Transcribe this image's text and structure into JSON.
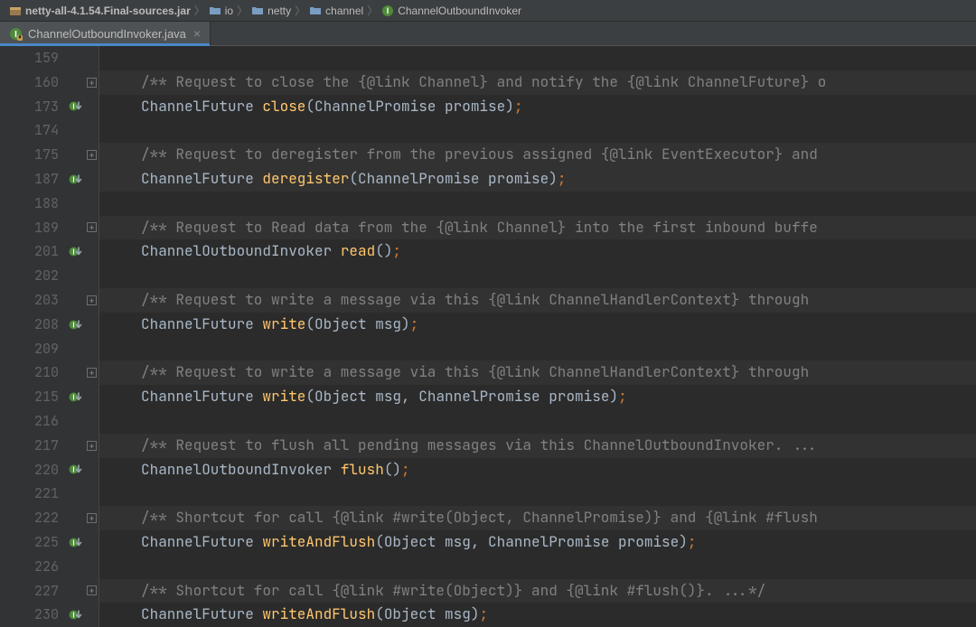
{
  "breadcrumb": {
    "jar": "netty-all-4.1.54.Final-sources.jar",
    "seg1": "io",
    "seg2": "netty",
    "seg3": "channel",
    "cls": "ChannelOutboundInvoker"
  },
  "tab": {
    "label": "ChannelOutboundInvoker.java"
  },
  "lines": [
    {
      "n": "159",
      "icon": "",
      "fold": "",
      "code": {
        "indent": "",
        "tokens": []
      },
      "bg": ""
    },
    {
      "n": "160",
      "icon": "",
      "fold": "+",
      "code": {
        "indent": "",
        "tokens": [
          [
            "comment",
            "/** Request to close the {@link Channel} and notify the {@link ChannelFuture} o"
          ]
        ]
      },
      "bg": "c"
    },
    {
      "n": "173",
      "icon": "impl",
      "fold": "",
      "code": {
        "indent": "",
        "tokens": [
          [
            "type",
            "ChannelFuture "
          ],
          [
            "method",
            "close"
          ],
          [
            "paren",
            "("
          ],
          [
            "type",
            "ChannelPromise promise"
          ],
          [
            "paren",
            ")"
          ],
          [
            "semi",
            ";"
          ]
        ]
      },
      "bg": ""
    },
    {
      "n": "174",
      "icon": "",
      "fold": "",
      "code": {
        "indent": "",
        "tokens": []
      },
      "bg": ""
    },
    {
      "n": "175",
      "icon": "",
      "fold": "+",
      "code": {
        "indent": "",
        "tokens": [
          [
            "comment",
            "/** Request to deregister from the previous assigned {@link EventExecutor} and"
          ]
        ]
      },
      "bg": "c"
    },
    {
      "n": "187",
      "icon": "impl",
      "fold": "",
      "code": {
        "indent": "",
        "tokens": [
          [
            "type",
            "ChannelFuture "
          ],
          [
            "method",
            "deregister"
          ],
          [
            "paren",
            "("
          ],
          [
            "type",
            "ChannelPromise promise"
          ],
          [
            "paren",
            ")"
          ],
          [
            "semi",
            ";"
          ]
        ]
      },
      "bg": "cur"
    },
    {
      "n": "188",
      "icon": "",
      "fold": "",
      "code": {
        "indent": "",
        "tokens": []
      },
      "bg": ""
    },
    {
      "n": "189",
      "icon": "",
      "fold": "+",
      "code": {
        "indent": "",
        "tokens": [
          [
            "comment",
            "/** Request to Read data from the {@link Channel} into the first inbound buffe"
          ]
        ]
      },
      "bg": "c"
    },
    {
      "n": "201",
      "icon": "impl",
      "fold": "",
      "code": {
        "indent": "",
        "tokens": [
          [
            "type",
            "ChannelOutboundInvoker "
          ],
          [
            "method",
            "read"
          ],
          [
            "paren",
            "()"
          ],
          [
            "semi",
            ";"
          ]
        ]
      },
      "bg": ""
    },
    {
      "n": "202",
      "icon": "",
      "fold": "",
      "code": {
        "indent": "",
        "tokens": []
      },
      "bg": ""
    },
    {
      "n": "203",
      "icon": "",
      "fold": "+",
      "code": {
        "indent": "",
        "tokens": [
          [
            "comment",
            "/** Request to write a message via this {@link ChannelHandlerContext} through "
          ]
        ]
      },
      "bg": "c"
    },
    {
      "n": "208",
      "icon": "impl",
      "fold": "",
      "code": {
        "indent": "",
        "tokens": [
          [
            "type",
            "ChannelFuture "
          ],
          [
            "method",
            "write"
          ],
          [
            "paren",
            "("
          ],
          [
            "type",
            "Object msg"
          ],
          [
            "paren",
            ")"
          ],
          [
            "semi",
            ";"
          ]
        ]
      },
      "bg": ""
    },
    {
      "n": "209",
      "icon": "",
      "fold": "",
      "code": {
        "indent": "",
        "tokens": []
      },
      "bg": ""
    },
    {
      "n": "210",
      "icon": "",
      "fold": "+",
      "code": {
        "indent": "",
        "tokens": [
          [
            "comment",
            "/** Request to write a message via this {@link ChannelHandlerContext} through "
          ]
        ]
      },
      "bg": "c"
    },
    {
      "n": "215",
      "icon": "impl",
      "fold": "",
      "code": {
        "indent": "",
        "tokens": [
          [
            "type",
            "ChannelFuture "
          ],
          [
            "method",
            "write"
          ],
          [
            "paren",
            "("
          ],
          [
            "type",
            "Object msg"
          ],
          [
            "paren",
            ", "
          ],
          [
            "type",
            "ChannelPromise promise"
          ],
          [
            "paren",
            ")"
          ],
          [
            "semi",
            ";"
          ]
        ]
      },
      "bg": ""
    },
    {
      "n": "216",
      "icon": "",
      "fold": "",
      "code": {
        "indent": "",
        "tokens": []
      },
      "bg": ""
    },
    {
      "n": "217",
      "icon": "",
      "fold": "+",
      "code": {
        "indent": "",
        "tokens": [
          [
            "comment",
            "/** Request to flush all pending messages via this ChannelOutboundInvoker. ..."
          ]
        ]
      },
      "bg": "c"
    },
    {
      "n": "220",
      "icon": "impl",
      "fold": "",
      "code": {
        "indent": "",
        "tokens": [
          [
            "type",
            "ChannelOutboundInvoker "
          ],
          [
            "method",
            "flush"
          ],
          [
            "paren",
            "()"
          ],
          [
            "semi",
            ";"
          ]
        ]
      },
      "bg": ""
    },
    {
      "n": "221",
      "icon": "",
      "fold": "",
      "code": {
        "indent": "",
        "tokens": []
      },
      "bg": ""
    },
    {
      "n": "222",
      "icon": "",
      "fold": "+",
      "code": {
        "indent": "",
        "tokens": [
          [
            "comment",
            "/** Shortcut for call {@link #write(Object, ChannelPromise)} and {@link #flush"
          ]
        ]
      },
      "bg": "c"
    },
    {
      "n": "225",
      "icon": "impl",
      "fold": "",
      "code": {
        "indent": "",
        "tokens": [
          [
            "type",
            "ChannelFuture "
          ],
          [
            "method",
            "writeAndFlush"
          ],
          [
            "paren",
            "("
          ],
          [
            "type",
            "Object msg"
          ],
          [
            "paren",
            ", "
          ],
          [
            "type",
            "ChannelPromise promise"
          ],
          [
            "paren",
            ")"
          ],
          [
            "semi",
            ";"
          ]
        ]
      },
      "bg": ""
    },
    {
      "n": "226",
      "icon": "",
      "fold": "",
      "code": {
        "indent": "",
        "tokens": []
      },
      "bg": ""
    },
    {
      "n": "227",
      "icon": "",
      "fold": "+",
      "code": {
        "indent": "",
        "tokens": [
          [
            "comment",
            "/** Shortcut for call {@link #write(Object)} and {@link #flush()}. ...*/"
          ]
        ]
      },
      "bg": "c"
    },
    {
      "n": "230",
      "icon": "impl",
      "fold": "",
      "code": {
        "indent": "",
        "tokens": [
          [
            "type",
            "ChannelFuture "
          ],
          [
            "method",
            "writeAndFlush"
          ],
          [
            "paren",
            "("
          ],
          [
            "type",
            "Object msg"
          ],
          [
            "paren",
            ")"
          ],
          [
            "semi",
            ";"
          ]
        ]
      },
      "bg": ""
    }
  ]
}
